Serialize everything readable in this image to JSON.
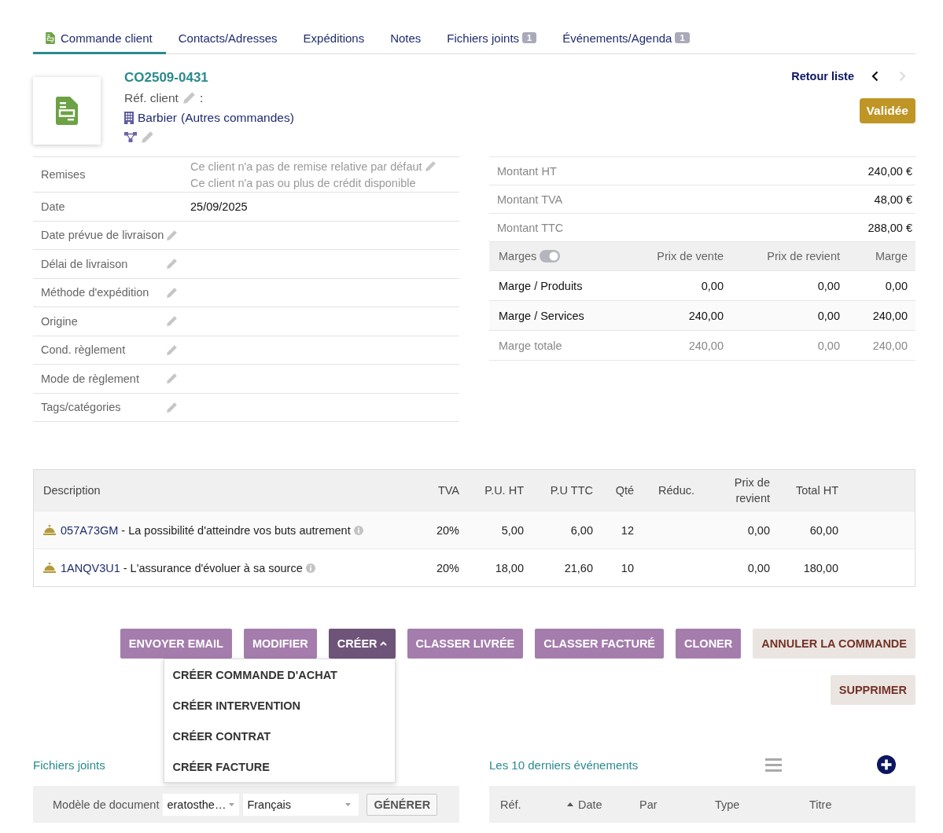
{
  "tabs": [
    {
      "label": "Commande client",
      "selected": true
    },
    {
      "label": "Contacts/Adresses",
      "selected": false
    },
    {
      "label": "Expéditions",
      "selected": false
    },
    {
      "label": "Notes",
      "selected": false
    },
    {
      "label": "Fichiers joints",
      "badge": "1",
      "selected": false
    },
    {
      "label": "Événements/Agenda",
      "badge": "1",
      "selected": false
    }
  ],
  "header": {
    "ref": "CO2509-0431",
    "ref_client_label": "Réf. client",
    "ref_client_colon": ":",
    "thirdparty": "Barbier",
    "other_orders": "(Autres commandes)",
    "back_link": "Retour liste",
    "previous": {
      "disabled": false
    },
    "next": {
      "disabled": true
    },
    "status": "Validée"
  },
  "fields": [
    {
      "label": "Remises",
      "editable": false,
      "notes": [
        {
          "text": "Ce client n'a pas de remise relative par défaut",
          "editable": true
        },
        {
          "text": "Ce client n'a pas ou plus de crédit disponible",
          "editable": false
        }
      ]
    },
    {
      "label": "Date",
      "editable": false,
      "value": "25/09/2025"
    },
    {
      "label": "Date prévue de livraison",
      "editable": true
    },
    {
      "label": "Délai de livraison",
      "editable": true
    },
    {
      "label": "Méthode d'expédition",
      "editable": true
    },
    {
      "label": "Origine",
      "editable": true
    },
    {
      "label": "Cond. règlement",
      "editable": true
    },
    {
      "label": "Mode de règlement",
      "editable": true
    },
    {
      "label": "Tags/catégories",
      "editable": true
    }
  ],
  "totals": [
    {
      "label": "Montant HT",
      "value": "240,00 €"
    },
    {
      "label": "Montant TVA",
      "value": "48,00 €"
    },
    {
      "label": "Montant TTC",
      "value": "288,00 €"
    }
  ],
  "margins": {
    "label": "Marges",
    "toggle_on": true,
    "columns": [
      "Prix de vente",
      "Prix de revient",
      "Marge"
    ],
    "rows": [
      {
        "label": "Marge / Produits",
        "kind": "detail",
        "values": [
          "0,00",
          "0,00",
          "0,00"
        ]
      },
      {
        "label": "Marge / Services",
        "kind": "detail",
        "values": [
          "240,00",
          "0,00",
          "240,00"
        ]
      },
      {
        "label": "Marge totale",
        "kind": "total",
        "values": [
          "240,00",
          "0,00",
          "240,00"
        ]
      }
    ]
  },
  "lines": {
    "columns": [
      "Description",
      "TVA",
      "P.U. HT",
      "P.U TTC",
      "Qté",
      "Réduc.",
      "Prix de revient",
      "Total HT"
    ],
    "rows": [
      {
        "ref": "057A73GM",
        "separator": "-",
        "label": "La possibilité d'atteindre vos buts autrement",
        "vat": "20%",
        "unit_ht": "5,00",
        "unit_ttc": "6,00",
        "qty": "12",
        "cost": "0,00",
        "total_ht": "60,00"
      },
      {
        "ref": "1ANQV3U1",
        "separator": "-",
        "label": "L'assurance d'évoluer à sa source",
        "vat": "20%",
        "unit_ht": "18,00",
        "unit_ttc": "21,60",
        "qty": "10",
        "cost": "0,00",
        "total_ht": "180,00"
      }
    ]
  },
  "actions": [
    [
      {
        "label": "ENVOYER EMAIL",
        "kind": "primary"
      },
      {
        "label": "MODIFIER",
        "kind": "primary"
      },
      {
        "label": "CRÉER",
        "kind": "dropdown",
        "expanded": true,
        "menu": [
          "CRÉER COMMANDE D'ACHAT",
          "CRÉER INTERVENTION",
          "CRÉER CONTRAT",
          "CRÉER FACTURE"
        ]
      },
      {
        "label": "CLASSER LIVRÉE",
        "kind": "primary"
      },
      {
        "label": "CLASSER FACTURÉ",
        "kind": "primary"
      },
      {
        "label": "CLONER",
        "kind": "primary"
      },
      {
        "label": "ANNULER LA COMMANDE",
        "kind": "danger"
      }
    ],
    [
      {
        "label": "SUPPRIMER",
        "kind": "danger"
      }
    ]
  ],
  "documents": {
    "title": "Fichiers joints",
    "model_label": "Modèle de document",
    "model": "eratosthe…",
    "language": "Français",
    "generate": "GÉNÉRER"
  },
  "events": {
    "title": "Les 10 derniers événements",
    "columns": [
      {
        "label": "Réf.",
        "sorted": false
      },
      {
        "label": "Date",
        "sorted": true
      },
      {
        "label": "Par",
        "sorted": false
      },
      {
        "label": "Type",
        "sorted": false
      },
      {
        "label": "Titre",
        "sorted": false
      }
    ]
  }
}
